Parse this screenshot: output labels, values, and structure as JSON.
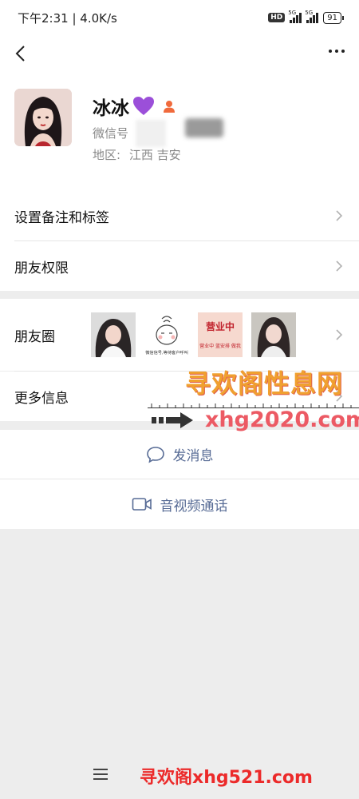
{
  "status_bar": {
    "time_speed": "下午2:31 | 4.0K/s",
    "hd": "HD",
    "network1": "5G",
    "network2": "5G",
    "battery": "91"
  },
  "nav": {
    "back_icon": "chevron-left-icon",
    "more_icon": "ellipsis-icon"
  },
  "profile": {
    "name": "冰冰",
    "heart_icon": "purple-heart-emoji",
    "gender_icon": "person-icon",
    "wechat_id_label": "微信号",
    "region_label": "地区:",
    "region_value": "江西  吉安"
  },
  "menu": {
    "remark_tags": "设置备注和标签",
    "permissions": "朋友权限",
    "moments": "朋友圈",
    "more_info": "更多信息"
  },
  "moments_thumbs": [
    {
      "name": "moments-photo-1"
    },
    {
      "name": "moments-photo-2",
      "caption": "微信信号,等待客户呼叫"
    },
    {
      "name": "moments-photo-3",
      "title": "营业中",
      "caption": "营业中 蓝安排 做我"
    },
    {
      "name": "moments-photo-4"
    }
  ],
  "actions": {
    "message": "发消息",
    "video_call": "音视频通话"
  },
  "watermarks": {
    "top_text": "寻欢阁性息网",
    "url1": "xhg2020.com",
    "bottom_text": "寻欢阁xhg521.com"
  },
  "colors": {
    "link_blue": "#576b95",
    "background": "#ededed",
    "watermark_orange": "#f0a030",
    "watermark_red": "#ec5a64"
  }
}
